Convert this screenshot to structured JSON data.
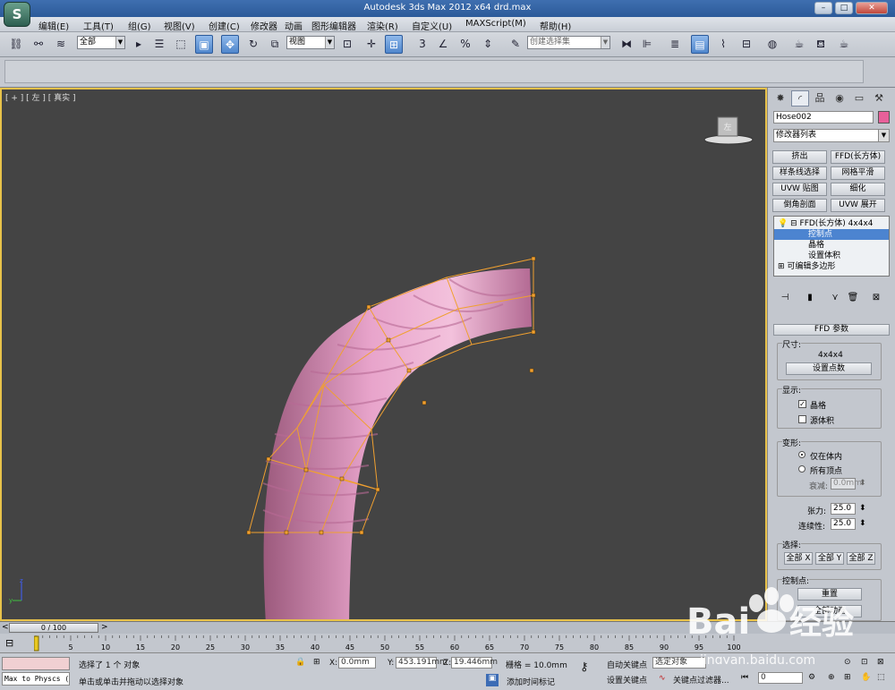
{
  "app": {
    "title": "Autodesk 3ds Max  2012 x64     drd.max",
    "logo": "3ds-max-logo",
    "window_buttons": [
      "–",
      "□",
      "✕"
    ]
  },
  "menu": [
    "编辑(E)",
    "工具(T)",
    "组(G)",
    "视图(V)",
    "创建(C)",
    "修改器",
    "动画",
    "图形编辑器",
    "渲染(R)",
    "自定义(U)",
    "MAXScript(M)",
    "帮助(H)"
  ],
  "toolbar": {
    "selection_filter": "全部",
    "ref_coord": "视图",
    "named_selection": "创建选择集"
  },
  "viewport": {
    "label": "[ + ] [ 左 ] [ 真实 ]",
    "viewcube_label": "左",
    "object_color": "#e39ac3",
    "lattice_color": "#f0a030"
  },
  "cmdpanel": {
    "object_name": "Hose002",
    "object_color": "#e8609a",
    "modifier_list": "修改器列表",
    "mod_buttons": [
      "挤出",
      "FFD(长方体)",
      "样条线选择",
      "网格平滑",
      "UVW 贴图",
      "细化",
      "倒角剖面",
      "UVW 展开"
    ],
    "stack": {
      "ffd": "FFD(长方体) 4x4x4",
      "control_points": "控制点",
      "lattice": "晶格",
      "set_volume": "设置体积",
      "editable_poly": "可编辑多边形"
    },
    "ffd_params": {
      "title": "FFD 参数",
      "dimensions_label": "尺寸:",
      "dimensions_value": "4x4x4",
      "set_points": "设置点数",
      "display_label": "显示:",
      "lattice": "晶格",
      "source_volume": "源体积",
      "deform_label": "变形:",
      "only_in_volume": "仅在体内",
      "all_vertices": "所有顶点",
      "falloff_label": "衰减:",
      "falloff_value": "0.0mm",
      "tension_label": "张力:",
      "tension_value": "25.0",
      "continuity_label": "连续性:",
      "continuity_value": "25.0",
      "select_label": "选择:",
      "all_x": "全部 X",
      "all_y": "全部 Y",
      "all_z": "全部 Z",
      "control_points_label": "控制点:",
      "reset": "重置",
      "animate_all": "全部动画"
    }
  },
  "timeline": {
    "frame": "0 / 100",
    "ticks": [
      "0",
      "5",
      "10",
      "15",
      "20",
      "25",
      "30",
      "35",
      "40",
      "45",
      "50",
      "55",
      "60",
      "65",
      "70",
      "75",
      "80",
      "85",
      "90",
      "95",
      "100"
    ]
  },
  "status": {
    "listener": "Max to Physcs (",
    "selected": "选择了 1 个 对象",
    "prompt": "单击或单击并拖动以选择对象",
    "x_label": "X:",
    "x_value": "0.0mm",
    "y_label": "Y:",
    "y_value": "453.191mm",
    "z_label": "Z:",
    "z_value": "19.446mm",
    "grid": "栅格 = 10.0mm",
    "add_time_tag": "添加时间标记",
    "auto_key": "自动关键点",
    "set_key": "设置关键点",
    "selected_obj": "选定对象",
    "key_filters": "关键点过滤器...",
    "frame_value": "0"
  },
  "watermark": {
    "brand": "Bai",
    "brand2": "经验",
    "url": "jingyan.baidu.com"
  }
}
